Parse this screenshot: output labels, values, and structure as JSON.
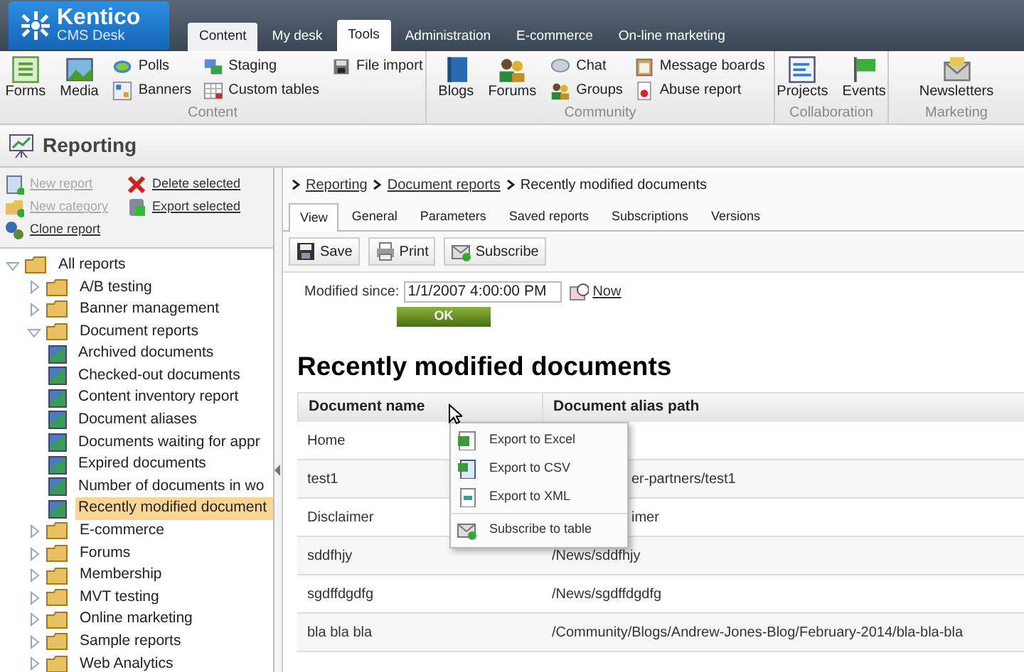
{
  "logo": {
    "name": "Kentico",
    "subtitle": "CMS Desk"
  },
  "app_tabs": [
    {
      "label": "Content",
      "selected": false,
      "highlighted": true
    },
    {
      "label": "My desk",
      "selected": false,
      "highlighted": false
    },
    {
      "label": "Tools",
      "selected": true,
      "highlighted": false
    },
    {
      "label": "Administration",
      "selected": false,
      "highlighted": false
    },
    {
      "label": "E-commerce",
      "selected": false,
      "highlighted": false
    },
    {
      "label": "On-line marketing",
      "selected": false,
      "highlighted": false
    }
  ],
  "ribbon": {
    "groups": [
      {
        "label": "Content",
        "large": [
          "Forms",
          "Media"
        ],
        "small": [
          "Polls",
          "Banners",
          "Staging",
          "Custom tables",
          "File import"
        ]
      },
      {
        "label": "Community",
        "large": [
          "Blogs",
          "Forums"
        ],
        "small": [
          "Chat",
          "Groups",
          "Message boards",
          "Abuse report"
        ]
      },
      {
        "label": "Collaboration",
        "large": [
          "Projects",
          "Events"
        ]
      },
      {
        "label": "Marketing",
        "large": [
          "Newsletters"
        ]
      }
    ]
  },
  "page_title": "Reporting",
  "sidebar": {
    "actions": [
      {
        "label": "New report",
        "disabled": true
      },
      {
        "label": "Delete selected",
        "disabled": false
      },
      {
        "label": "New category",
        "disabled": true
      },
      {
        "label": "Export selected",
        "disabled": false
      },
      {
        "label": "Clone report",
        "disabled": false
      }
    ],
    "tree": [
      {
        "label": "All reports",
        "kind": "folder",
        "expanded": true,
        "selected": false,
        "children": [
          {
            "label": "A/B testing",
            "kind": "folder",
            "expanded": false,
            "selected": false
          },
          {
            "label": "Banner management",
            "kind": "folder",
            "expanded": false,
            "selected": false
          },
          {
            "label": "Document reports",
            "kind": "folder",
            "expanded": true,
            "selected": false,
            "children": [
              {
                "label": "Archived documents",
                "kind": "report",
                "selected": false
              },
              {
                "label": "Checked-out documents",
                "kind": "report",
                "selected": false
              },
              {
                "label": "Content inventory report",
                "kind": "report",
                "selected": false
              },
              {
                "label": "Document aliases",
                "kind": "report",
                "selected": false
              },
              {
                "label": "Documents waiting for appr",
                "kind": "report",
                "selected": false
              },
              {
                "label": "Expired documents",
                "kind": "report",
                "selected": false
              },
              {
                "label": "Number of documents in wo",
                "kind": "report",
                "selected": false
              },
              {
                "label": "Recently modified document",
                "kind": "report",
                "selected": true
              }
            ]
          },
          {
            "label": "E-commerce",
            "kind": "folder",
            "expanded": false,
            "selected": false
          },
          {
            "label": "Forums",
            "kind": "folder",
            "expanded": false,
            "selected": false
          },
          {
            "label": "Membership",
            "kind": "folder",
            "expanded": false,
            "selected": false
          },
          {
            "label": "MVT testing",
            "kind": "folder",
            "expanded": false,
            "selected": false
          },
          {
            "label": "Online marketing",
            "kind": "folder",
            "expanded": false,
            "selected": false
          },
          {
            "label": "Sample reports",
            "kind": "folder",
            "expanded": false,
            "selected": false
          },
          {
            "label": "Web Analytics",
            "kind": "folder",
            "expanded": false,
            "selected": false
          }
        ]
      }
    ]
  },
  "breadcrumb": [
    {
      "label": "Reporting",
      "link": true
    },
    {
      "label": "Document reports",
      "link": true
    },
    {
      "label": "Recently modified documents",
      "link": false
    }
  ],
  "tabs": [
    {
      "label": "View",
      "selected": true
    },
    {
      "label": "General",
      "selected": false
    },
    {
      "label": "Parameters",
      "selected": false
    },
    {
      "label": "Saved reports",
      "selected": false
    },
    {
      "label": "Subscriptions",
      "selected": false
    },
    {
      "label": "Versions",
      "selected": false
    }
  ],
  "toolbar": [
    "Save",
    "Print",
    "Subscribe"
  ],
  "filter": {
    "label": "Modified since:",
    "value": "1/1/2007 4:00:00 PM",
    "now_link": "Now",
    "ok_button": "OK"
  },
  "report_title": "Recently modified documents",
  "table": {
    "columns": [
      "Document name",
      "Document alias path"
    ],
    "rows": [
      [
        "Home",
        ""
      ],
      [
        "test1",
        "er-partners/test1"
      ],
      [
        "Disclaimer",
        "imer"
      ],
      [
        "sddfhjy",
        "/News/sddfhjy"
      ],
      [
        "sgdffdgdfg",
        "/News/sgdffdgdfg"
      ],
      [
        "bla bla bla",
        "/Community/Blogs/Andrew-Jones-Blog/February-2014/bla-bla-bla"
      ]
    ]
  },
  "context_menu": [
    {
      "label": "Export to Excel",
      "kind": "excel"
    },
    {
      "label": "Export to CSV",
      "kind": "csv"
    },
    {
      "label": "Export to XML",
      "kind": "xml"
    },
    {
      "label": "Subscribe to table",
      "kind": "subscribe",
      "separator": true
    }
  ]
}
